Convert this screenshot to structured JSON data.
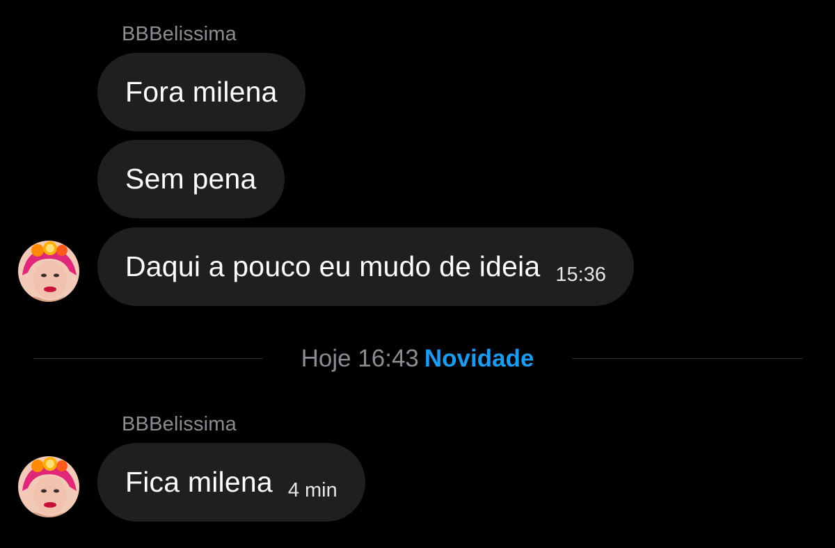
{
  "conversation": {
    "group1": {
      "sender": "BBBelissima",
      "messages": [
        {
          "text": "Fora milena",
          "time": ""
        },
        {
          "text": "Sem pena",
          "time": ""
        },
        {
          "text": "Daqui a pouco eu mudo de ideia",
          "time": "15:36"
        }
      ],
      "avatar_icon": "user-avatar-icon"
    },
    "divider": {
      "date_label": "Hoje 16:43",
      "new_label": "Novidade",
      "new_color": "#1d9bf0"
    },
    "group2": {
      "sender": "BBBelissima",
      "messages": [
        {
          "text": "Fica milena",
          "time": "4 min"
        }
      ],
      "avatar_icon": "user-avatar-icon"
    }
  },
  "colors": {
    "background": "#000000",
    "bubble": "#1f1f22",
    "sender_name": "#8b8d93",
    "accent": "#1d9bf0"
  }
}
